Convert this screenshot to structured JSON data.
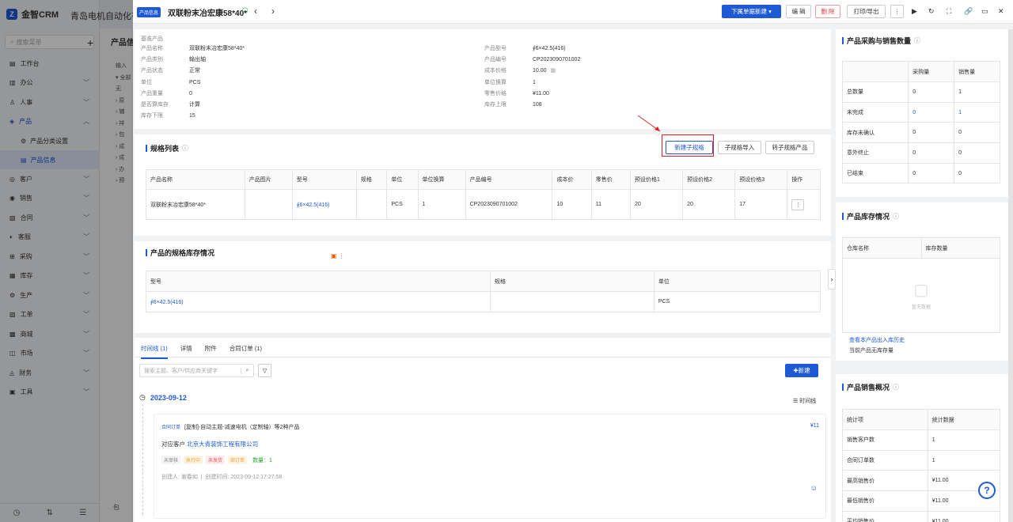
{
  "sidebar": {
    "app_name": "金智CRM",
    "company": "青岛电机自动化有",
    "search_placeholder": "搜索菜单",
    "items": [
      {
        "label": "工作台",
        "icon": "dashboard-icon"
      },
      {
        "label": "办公",
        "icon": "office-icon"
      },
      {
        "label": "人事",
        "icon": "person-icon"
      },
      {
        "label": "产品",
        "icon": "product-icon"
      },
      {
        "label": "客户",
        "icon": "customer-icon"
      },
      {
        "label": "销售",
        "icon": "sales-icon"
      },
      {
        "label": "合同",
        "icon": "contract-icon"
      },
      {
        "label": "客服",
        "icon": "service-icon"
      },
      {
        "label": "采购",
        "icon": "purchase-icon"
      },
      {
        "label": "库存",
        "icon": "stock-icon"
      },
      {
        "label": "生产",
        "icon": "production-icon"
      },
      {
        "label": "工单",
        "icon": "ticket-icon"
      },
      {
        "label": "商城",
        "icon": "shop-icon"
      },
      {
        "label": "市场",
        "icon": "market-icon"
      },
      {
        "label": "财务",
        "icon": "finance-icon"
      },
      {
        "label": "工具",
        "icon": "tool-icon"
      }
    ],
    "sub_items": [
      "产品分类设置",
      "产品信息"
    ]
  },
  "background_page": {
    "title": "产品信",
    "rows": [
      "输入",
      "▾ 全部",
      "无",
      "› 原",
      "› 辅",
      "› 祥",
      "› 包",
      "› 成",
      "› 成",
      "› 办",
      "› 预"
    ],
    "bottom_text": "包"
  },
  "header": {
    "tag": "产品信息",
    "title": "双联粉末冶宏康58*40*",
    "new_document_btn": "下属单据新建",
    "edit_btn": "编 辑",
    "delete_btn": "删 除",
    "print_btn": "打印/导出"
  },
  "basic": {
    "section_label": "基准产品",
    "left": [
      {
        "k": "产品名称",
        "v": "双联粉末冶宏康58*40*"
      },
      {
        "k": "产品类别",
        "v": "输出轴"
      },
      {
        "k": "产品状态",
        "v": "正常"
      },
      {
        "k": "单位",
        "v": "PCS"
      },
      {
        "k": "产品重量",
        "v": "0"
      },
      {
        "k": "是否算库存",
        "v": "计算"
      },
      {
        "k": "库存下限",
        "v": "15"
      }
    ],
    "right": [
      {
        "k": "产品型号",
        "v": "∮6×42.5(416)"
      },
      {
        "k": "产品编号",
        "v": "CP2023090701002"
      },
      {
        "k": "成本价格",
        "v": "10.00"
      },
      {
        "k": "单位换算",
        "v": "1"
      },
      {
        "k": "零售价格",
        "v": "¥11.00"
      },
      {
        "k": "库存上限",
        "v": "108"
      }
    ]
  },
  "spec_list": {
    "title": "规格列表",
    "btn_new": "新建子规格",
    "btn_import": "子规格导入",
    "btn_convert": "转子规格产品",
    "columns": [
      "产品名称",
      "产品图片",
      "型号",
      "规格",
      "单位",
      "单位换算",
      "产品编号",
      "成本价",
      "零售价",
      "预设价格1",
      "预设价格2",
      "预设价格3",
      "操作"
    ],
    "rows": [
      [
        "双联粉末冶宏康58*40*",
        "",
        "∮6×42.5(416)",
        "",
        "PCS",
        "1",
        "CP2023090701002",
        "10",
        "11",
        "20",
        "20",
        "17",
        ""
      ]
    ]
  },
  "stock_spec": {
    "title": "产品的规格库存情况",
    "columns": [
      "型号",
      "规格",
      "单位"
    ],
    "rows": [
      [
        "∮6×42.5(416)",
        "",
        "PCS"
      ]
    ]
  },
  "timeline": {
    "tabs": [
      "时间线 (1)",
      "详情",
      "附件",
      "合同订单 (1)"
    ],
    "search_placeholder": "搜索主题、客户/供应商关键字",
    "new_btn": "新建",
    "date": "2023-09-12",
    "view_label": "时间线",
    "entry": {
      "type": "合同订单",
      "subject": "[复制]-自动主题-减速电机（定制轴）等2种产品",
      "amount": "¥11",
      "customer_label": "对应客户",
      "customer": "北京大青装饰工程有限公司",
      "pills": [
        "未审核",
        "执行中",
        "未发货",
        "部订单"
      ],
      "qty": "数量：1",
      "creator": "创建人: 谢春如",
      "created": "创建时间: 2023-09-12 17:27:58"
    }
  },
  "purchase": {
    "title": "产品采购与销售数量",
    "columns": [
      "",
      "采购量",
      "销售量"
    ],
    "rows": [
      [
        "总数量",
        "0",
        "1"
      ],
      [
        "未完成",
        "0",
        "1"
      ],
      [
        "库存未确认",
        "0",
        "0"
      ],
      [
        "意外终止",
        "0",
        "0"
      ],
      [
        "已结束",
        "0",
        "0"
      ]
    ]
  },
  "inventory": {
    "title": "产品库存情况",
    "columns": [
      "仓库名称",
      "库存数量"
    ],
    "empty": "暂无数据",
    "history_link": "查看本产品出入库历史",
    "no_stock": "当前产品无库存量"
  },
  "sales": {
    "title": "产品销售概况",
    "columns": [
      "统计项",
      "统计数据"
    ],
    "rows": [
      [
        "销售客户数",
        "1"
      ],
      [
        "合同订单数",
        "1"
      ],
      [
        "最高销售价",
        "¥11.00"
      ],
      [
        "最低销售价",
        "¥11.00"
      ],
      [
        "平均销售价",
        "¥11.00"
      ]
    ]
  },
  "colors": {
    "accent": "#1e5ad6",
    "danger": "#ee3333",
    "annotation": "#e02020"
  }
}
